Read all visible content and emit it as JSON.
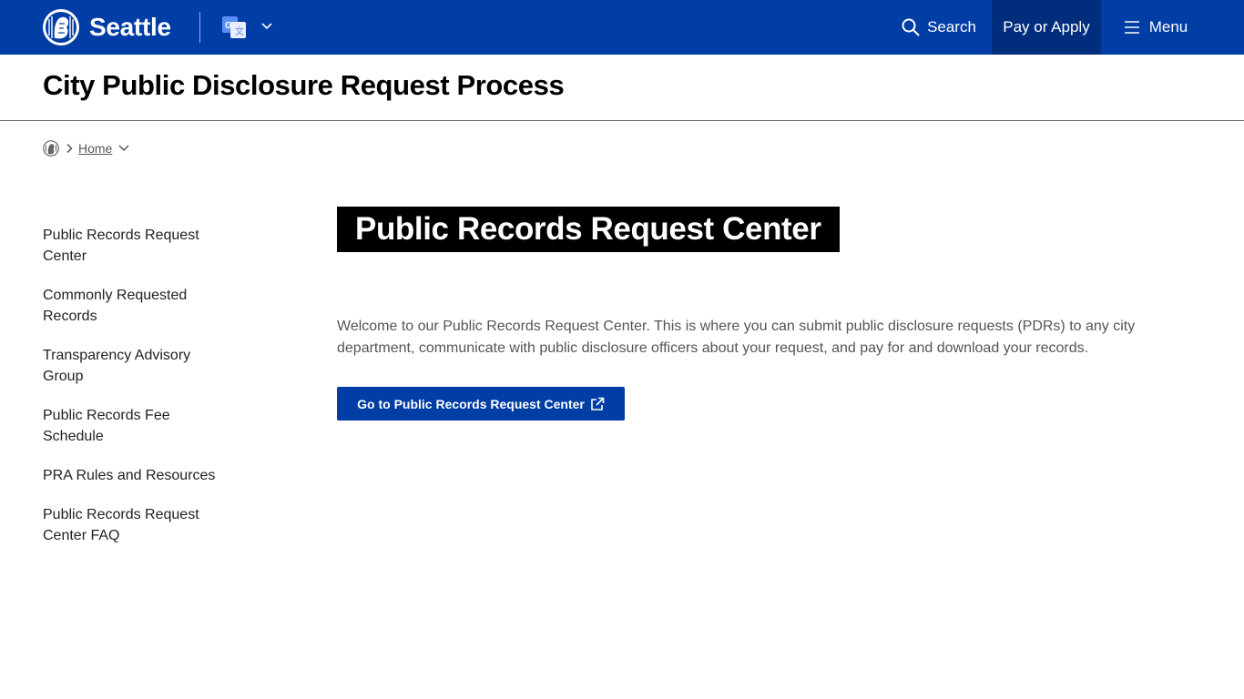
{
  "header": {
    "brand": "Seattle",
    "search_label": "Search",
    "pay_label": "Pay or Apply",
    "menu_label": "Menu",
    "colors": {
      "bar": "#003da5",
      "pay_bg": "#002e7d"
    }
  },
  "page": {
    "title": "City Public Disclosure Request Process"
  },
  "breadcrumb": {
    "home_label": "Home"
  },
  "sidebar": {
    "items": [
      {
        "label": "Public Records Request Center"
      },
      {
        "label": "Commonly Requested Records"
      },
      {
        "label": "Transparency Advisory Group"
      },
      {
        "label": "Public Records Fee Schedule"
      },
      {
        "label": "PRA Rules and Resources"
      },
      {
        "label": "Public Records Request Center FAQ"
      }
    ]
  },
  "main": {
    "heading": "Public Records Request Center",
    "intro": "Welcome to our Public Records Request Center. This is where you can submit public disclosure requests (PDRs) to any city department, communicate with public disclosure officers about your request, and pay for and download your records.",
    "cta_label": "Go to Public Records Request Center"
  },
  "icons": [
    "seattle-seal-icon",
    "translate-icon",
    "chevron-down-icon",
    "search-icon",
    "hamburger-icon",
    "chevron-right-icon",
    "external-link-icon"
  ]
}
